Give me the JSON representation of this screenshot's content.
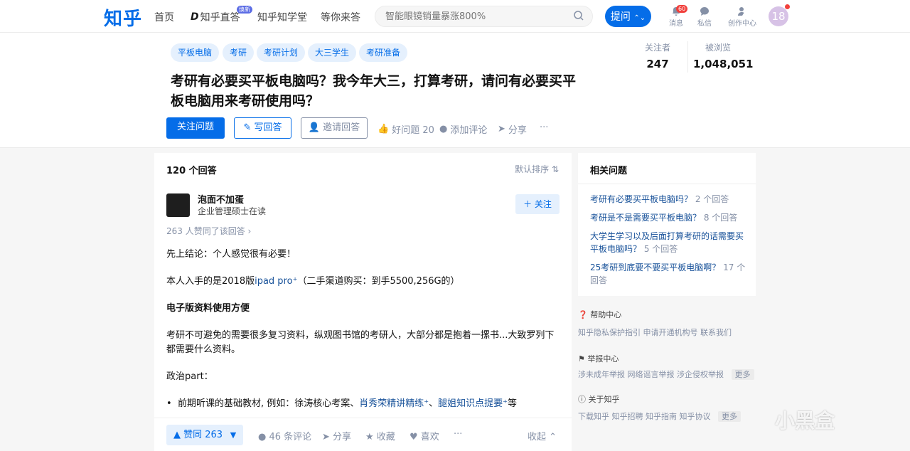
{
  "nav": {
    "logo": "知乎",
    "home": "首页",
    "zhida": "知乎直答",
    "zhida_badge": "焕新",
    "xuetang": "知乎知学堂",
    "waiting": "等你来答"
  },
  "search": {
    "placeholder": "智能眼镜销量暴涨800%"
  },
  "ask_label": "提问",
  "tools": {
    "messages": "消息",
    "messages_badge": "60",
    "dm": "私信",
    "creator": "创作中心"
  },
  "user_avatar_text": "18",
  "topics": [
    "平板电脑",
    "考研",
    "考研计划",
    "大三学生",
    "考研准备"
  ],
  "question": {
    "title": "考研有必要买平板电脑吗？我今年大三，打算考研，请问有必要买平板电脑用来考研使用吗？"
  },
  "stats": {
    "followers_label": "关注者",
    "followers": "247",
    "views_label": "被浏览",
    "views": "1,048,051"
  },
  "actions": {
    "follow": "关注问题",
    "write": "写回答",
    "invite": "邀请回答",
    "good": "好问题 20",
    "comment": "添加评论",
    "share": "分享",
    "more": "···"
  },
  "answers": {
    "count": "120 个回答",
    "sort": "默认排序"
  },
  "answer": {
    "author": "泡面不加蛋",
    "headline": "企业管理硕士在读",
    "follow": "关注",
    "vote_note": "263 人赞同了该回答 ›",
    "p1": "先上结论：个人感觉很有必要！",
    "p2a": "本人入手的是2018版",
    "p2link": "ipad pro",
    "p2b": "（二手渠道购买：到手5500,256G的）",
    "p3": "电子版资料使用方便",
    "p4": "考研不可避免的需要很多复习资料，纵观图书馆的考研人，大部分都是抱着一摞书...大致罗列下都需要什么资料。",
    "p5": "政治part：",
    "li1a": "前期听课的基础教材, 例如：徐涛核心考案、",
    "li1link1": "肖秀荣精讲精练",
    "li1sep": "、",
    "li1link2": "腿姐知识点提要",
    "li1b": "等",
    "vote": "▲ 赞同 263",
    "comments": "46 条评论",
    "share": "分享",
    "collect": "收藏",
    "like": "喜欢",
    "more": "···",
    "collapse": "收起"
  },
  "related": {
    "title": "相关问题",
    "items": [
      {
        "q": "考研有必要买平板电脑吗？",
        "n": "2 个回答"
      },
      {
        "q": "考研是不是需要买平板电脑？",
        "n": "8 个回答"
      },
      {
        "q": "大学生学习以及后面打算考研的话需要买平板电脑吗？",
        "n": "5 个回答"
      },
      {
        "q": "25考研到底要不要买平板电脑啊？",
        "n": "17 个回答"
      }
    ]
  },
  "footer": {
    "help": "帮助中心",
    "help_links": "知乎隐私保护指引   申请开通机构号   联系我们",
    "report": "举报中心",
    "report_links": "涉未成年举报   网络谣言举报   涉企侵权举报",
    "more": "更多",
    "about": "关于知乎",
    "about_links": "下载知乎   知乎招聘   知乎指南   知乎协议"
  },
  "watermark": "小黑盒"
}
